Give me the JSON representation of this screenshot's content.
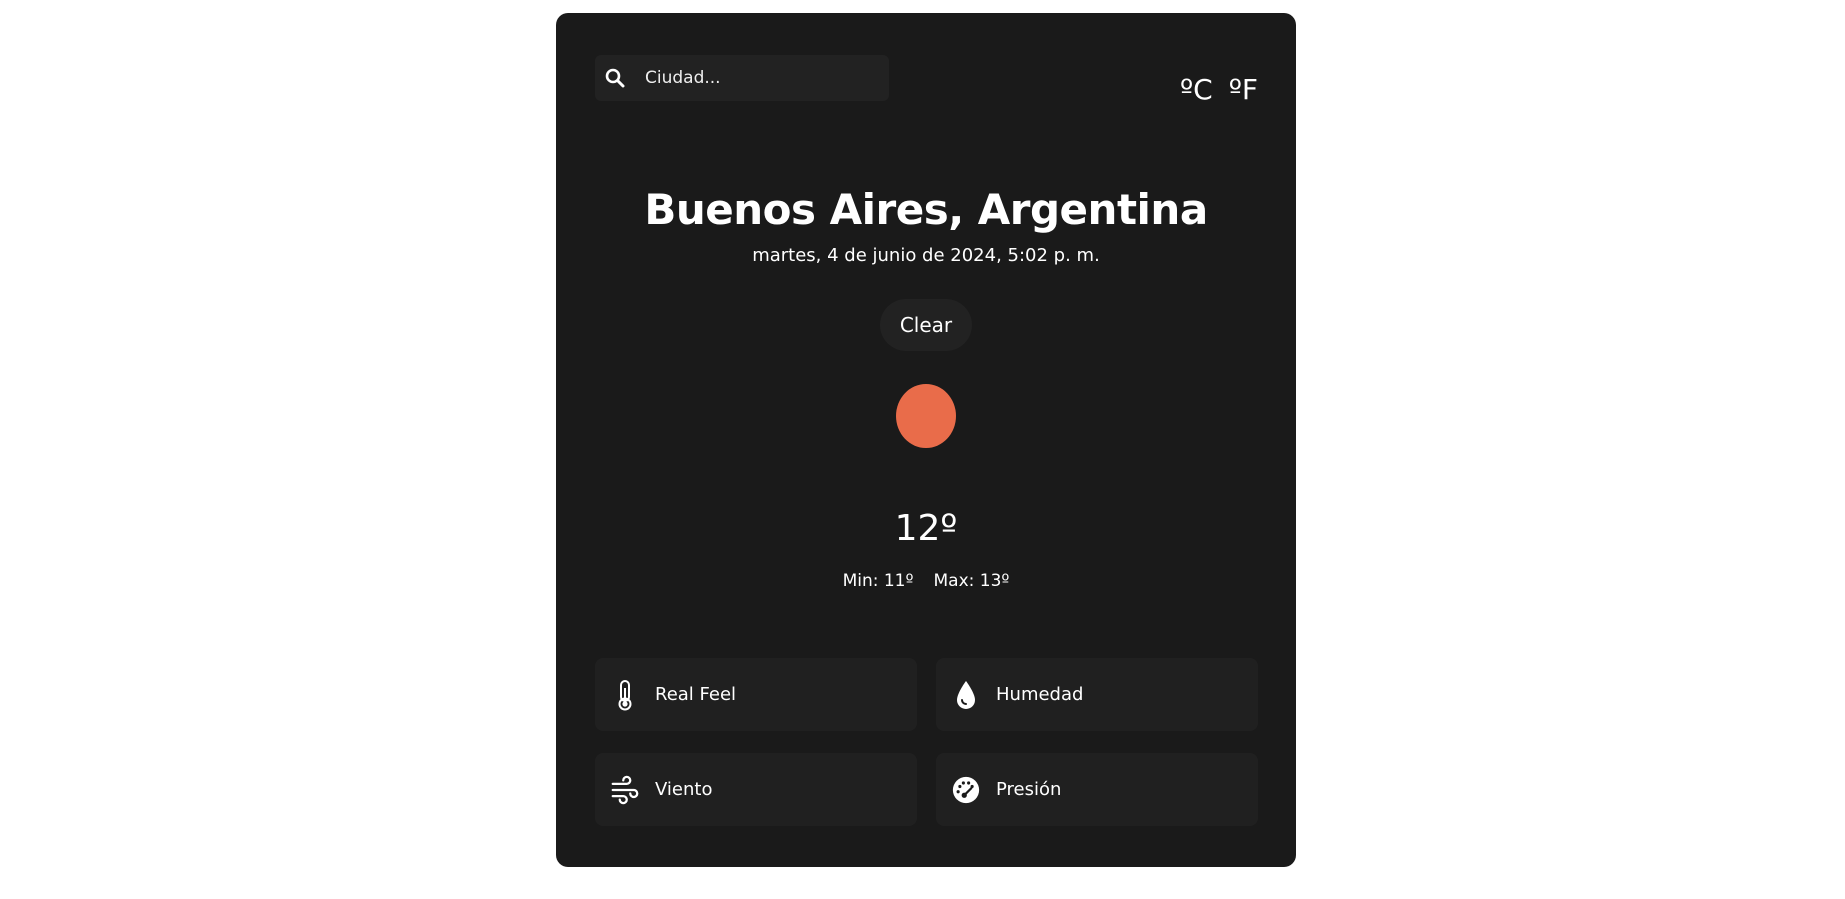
{
  "search": {
    "placeholder": "Ciudad...",
    "icon": "search-icon"
  },
  "units": {
    "celsius": "ºC",
    "fahrenheit": "ºF"
  },
  "location": {
    "city": "Buenos Aires, Argentina",
    "datetime": "martes, 4 de junio de 2024, 5:02 p. m."
  },
  "weather": {
    "condition": "Clear",
    "icon": "sun-icon",
    "icon_color": "#e96c4a",
    "temperature": "12º",
    "min": "Min: 11º",
    "max": "Max: 13º"
  },
  "details": [
    {
      "label": "Real Feel",
      "icon": "thermometer-icon"
    },
    {
      "label": "Humedad",
      "icon": "droplet-icon"
    },
    {
      "label": "Viento",
      "icon": "wind-icon"
    },
    {
      "label": "Presión",
      "icon": "gauge-icon"
    }
  ],
  "colors": {
    "card_background": "#1a1a1a",
    "tile_background": "#202020",
    "page_background": "#ffffff",
    "text": "#ffffff"
  }
}
